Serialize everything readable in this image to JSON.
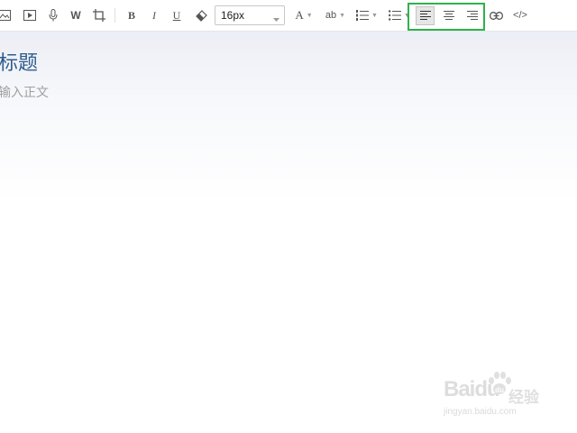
{
  "toolbar": {
    "font_size_value": "16px",
    "bold_label": "B",
    "italic_label": "I",
    "underline_label": "U",
    "word_label": "W",
    "font_color_label": "A",
    "highlight_label": "ab",
    "code_label": "</>",
    "icons": [
      "image-icon",
      "video-icon",
      "microphone-icon",
      "word-icon",
      "crop-icon",
      "bold-icon",
      "italic-icon",
      "underline-icon",
      "eraser-icon",
      "font-color-icon",
      "highlight-icon",
      "ordered-list-icon",
      "unordered-list-icon",
      "align-left-icon",
      "align-center-icon",
      "align-right-icon",
      "link-icon",
      "code-icon"
    ],
    "active_alignment": "left",
    "highlight_color": "#2fb24a"
  },
  "editor": {
    "title_placeholder": "标题",
    "body_placeholder": "输入正文",
    "title_color": "#2e5d8e"
  },
  "watermark": {
    "brand": "Baidu",
    "brand_cn": "经验",
    "url": "jingyan.baidu.com"
  }
}
